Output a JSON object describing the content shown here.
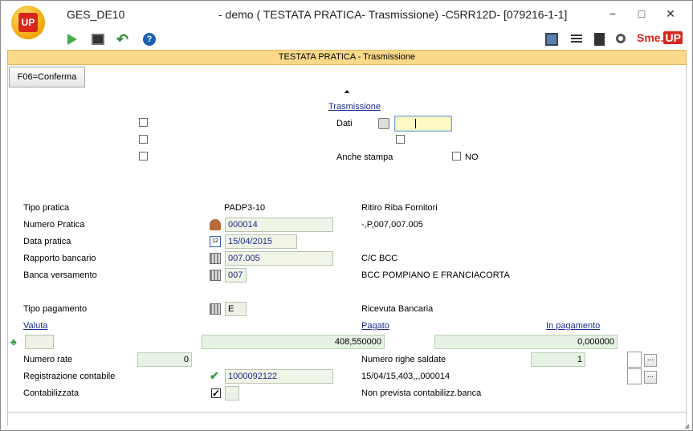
{
  "window": {
    "app_name": "GES_DE10",
    "title": "- demo ( TESTATA PRATICA- Trasmissione) -C5RR12D- [079216-1-1]",
    "logo_text": "UP",
    "minimize": "−",
    "maximize": "□",
    "close": "✕"
  },
  "toolbar": {
    "brand_sme": "Sme.",
    "brand_up": "UP"
  },
  "section": {
    "title": "TESTATA PRATICA -  Trasmissione"
  },
  "actions": {
    "confirm_label": "F06=Conferma"
  },
  "trasmissione": {
    "link": "Trasmissione",
    "dati_label": "Dati",
    "dati_value": "",
    "anche_stampa_label": "Anche stampa",
    "anche_stampa_value": "NO"
  },
  "details": {
    "tipo_pratica": {
      "label": "Tipo pratica",
      "code": "PADP3-10",
      "desc": "Ritiro Riba Fornitori"
    },
    "numero_pratica": {
      "label": "Numero Pratica",
      "value": "000014",
      "desc": "-,P,007,007.005"
    },
    "data_pratica": {
      "label": "Data pratica",
      "value": "15/04/2015",
      "cal_day": "12"
    },
    "rapporto_bancario": {
      "label": "Rapporto bancario",
      "value": "007.005",
      "desc": "C/C BCC"
    },
    "banca_versamento": {
      "label": "Banca versamento",
      "value": "007",
      "desc": "BCC POMPIANO E FRANCIACORTA"
    },
    "tipo_pagamento": {
      "label": "Tipo pagamento",
      "value": "E",
      "desc": "Ricevuta Bancaria"
    }
  },
  "totals": {
    "valuta_label": "Valuta",
    "valuta_value": "",
    "pagato_label": "Pagato",
    "pagato_value": "408,550000",
    "in_pagamento_label": "In pagamento",
    "in_pagamento_value": "0,000000"
  },
  "bottom": {
    "numero_rate": {
      "label": "Numero rate",
      "value": "0"
    },
    "numero_righe_saldate": {
      "label": "Numero righe saldate",
      "value": "1"
    },
    "registrazione_contabile": {
      "label": "Registrazione contabile",
      "value": "1000092122",
      "desc": "15/04/15,403,,,000014"
    },
    "contabilizzata": {
      "label": "Contabilizzata",
      "checked_mark": "✓",
      "desc": "Non prevista contabilizz.banca"
    },
    "dots": "..."
  }
}
